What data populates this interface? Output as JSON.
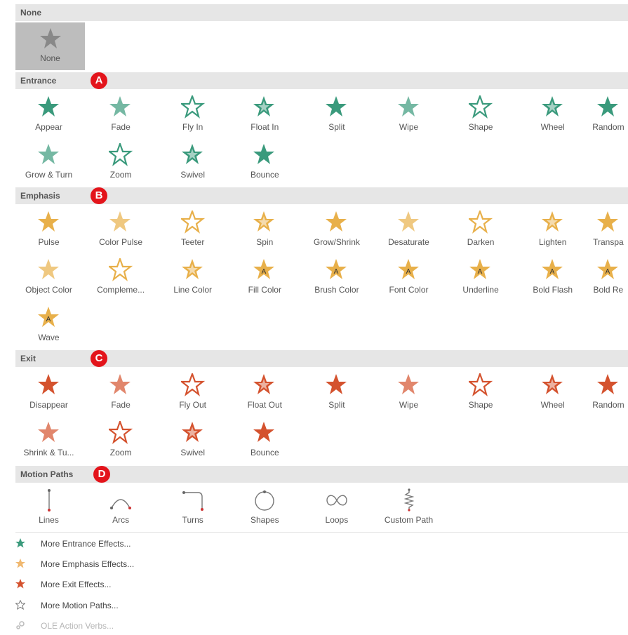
{
  "sections": {
    "none": {
      "title": "None",
      "item": "None"
    },
    "entrance": {
      "title": "Entrance",
      "badge": "A",
      "items": [
        "Appear",
        "Fade",
        "Fly In",
        "Float In",
        "Split",
        "Wipe",
        "Shape",
        "Wheel",
        "Random",
        "Grow & Turn",
        "Zoom",
        "Swivel",
        "Bounce"
      ]
    },
    "emphasis": {
      "title": "Emphasis",
      "badge": "B",
      "items": [
        "Pulse",
        "Color Pulse",
        "Teeter",
        "Spin",
        "Grow/Shrink",
        "Desaturate",
        "Darken",
        "Lighten",
        "Transpa",
        "Object Color",
        "Compleme...",
        "Line Color",
        "Fill Color",
        "Brush Color",
        "Font Color",
        "Underline",
        "Bold Flash",
        "Bold Re",
        "Wave"
      ]
    },
    "exit": {
      "title": "Exit",
      "badge": "C",
      "items": [
        "Disappear",
        "Fade",
        "Fly Out",
        "Float Out",
        "Split",
        "Wipe",
        "Shape",
        "Wheel",
        "Random",
        "Shrink & Tu...",
        "Zoom",
        "Swivel",
        "Bounce"
      ]
    },
    "motion": {
      "title": "Motion Paths",
      "badge": "D",
      "items": [
        "Lines",
        "Arcs",
        "Turns",
        "Shapes",
        "Loops",
        "Custom Path"
      ]
    }
  },
  "menu": {
    "more_entrance": "More Entrance Effects...",
    "more_emphasis": "More Emphasis Effects...",
    "more_exit": "More Exit Effects...",
    "more_motion": "More Motion Paths...",
    "ole": "OLE Action Verbs..."
  },
  "colors": {
    "entrance": "#3a9a7c",
    "emphasis": "#e8b04a",
    "exit": "#d4522e",
    "badge": "#e3141b",
    "header_bg": "#e6e6e6"
  }
}
